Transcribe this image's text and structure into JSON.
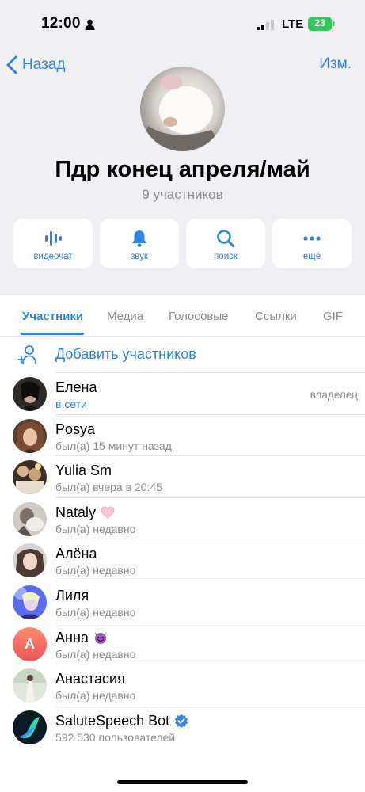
{
  "status_bar": {
    "time": "12:00",
    "network": "LTE",
    "battery": "23"
  },
  "nav": {
    "back_label": "Назад",
    "edit_label": "Изм."
  },
  "group": {
    "title": "Пдр конец апреля/май",
    "subtitle": "9 участников"
  },
  "actions": [
    {
      "label": "видеочат",
      "icon": "voice-wave-icon"
    },
    {
      "label": "звук",
      "icon": "bell-icon"
    },
    {
      "label": "поиск",
      "icon": "search-icon"
    },
    {
      "label": "ещё",
      "icon": "more-icon"
    }
  ],
  "tabs": [
    {
      "label": "Участники",
      "active": true
    },
    {
      "label": "Медиа"
    },
    {
      "label": "Голосовые"
    },
    {
      "label": "Ссылки"
    },
    {
      "label": "GIF"
    }
  ],
  "add_members": {
    "label": "Добавить участников",
    "icon": "add-user-icon"
  },
  "members": [
    {
      "name": "Елена",
      "status": "в сети",
      "role": "владелец",
      "online": true
    },
    {
      "name": "Posya",
      "status": "был(а) 15 минут назад"
    },
    {
      "name": "Yulia Sm",
      "status": "был(а) вчера в 20:45"
    },
    {
      "name": "Nataly",
      "status": "был(а) недавно",
      "badge": "pink-heart-icon"
    },
    {
      "name": "Алёна",
      "status": "был(а) недавно"
    },
    {
      "name": "Лиля",
      "status": "был(а) недавно"
    },
    {
      "name": "Анна",
      "status": "был(а) недавно",
      "badge": "smiling-devil-icon",
      "avatar_letter": "А"
    },
    {
      "name": "Анастасия",
      "status": "был(а) недавно"
    },
    {
      "name": "SaluteSpeech Bot",
      "status": "592 530 пользователей",
      "badge": "verified-icon"
    }
  ],
  "colors": {
    "accent": "#2f83e7",
    "secondary_text": "#8e8e93",
    "header_bg": "#efeff4",
    "battery_green": "#34c759"
  }
}
